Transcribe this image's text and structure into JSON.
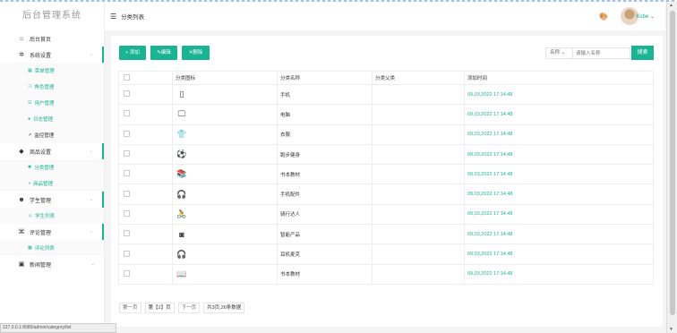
{
  "sidebar": {
    "logo": "后台管理系统",
    "items": [
      {
        "label": "后台首页",
        "icon": "home-icon",
        "glyph": "⌂"
      },
      {
        "label": "系统设置",
        "icon": "gear-icon",
        "glyph": "✲",
        "chevron": "⌄",
        "children": [
          {
            "label": "菜单管理",
            "glyph": "▦"
          },
          {
            "label": "角色管理",
            "glyph": "⚇"
          },
          {
            "label": "用户管理",
            "glyph": "☷"
          },
          {
            "label": "日志管理",
            "glyph": "●"
          },
          {
            "label": "监控管理",
            "glyph": "↗"
          }
        ]
      },
      {
        "label": "商品设置",
        "icon": "shopping-bag-icon",
        "glyph": "◆",
        "chevron": "⌄",
        "children": [
          {
            "label": "分类管理",
            "glyph": "✱"
          },
          {
            "label": "商品管理",
            "glyph": "◑"
          }
        ]
      },
      {
        "label": "学生管理",
        "icon": "users-icon",
        "glyph": "☻",
        "chevron": "⌄",
        "children": [
          {
            "label": "学生列表",
            "glyph": "☺"
          }
        ]
      },
      {
        "label": "评论管理",
        "icon": "command-icon",
        "glyph": "⌘",
        "chevron": "⌄",
        "children": [
          {
            "label": "评论列表",
            "glyph": "▩"
          }
        ]
      },
      {
        "label": "新闻管理",
        "icon": "newspaper-icon",
        "glyph": "▣",
        "chevron": "⌄"
      }
    ]
  },
  "statusbar": "127.0.0.1:8080/admin/category/list",
  "header": {
    "menu_glyph": "☰",
    "title": "分类列表",
    "palette_glyph": "🎨",
    "user": "Kobe ⌄"
  },
  "toolbar": {
    "add": "+ 添加",
    "edit": "✎编辑",
    "delete": "✕删除",
    "select": "名称 ⌄",
    "search_placeholder": "请输入名称",
    "search": "搜索"
  },
  "table": {
    "headers": [
      "",
      "分类图标",
      "分类名称",
      "分类父类",
      "添加时间"
    ],
    "rows": [
      {
        "icon": "▯",
        "icon_name": "phone-icon",
        "name": "手机",
        "parent": "",
        "date": "09,03,2022 17:14:48"
      },
      {
        "icon": "🖵",
        "icon_name": "monitor-icon",
        "name": "电脑",
        "parent": "",
        "date": "09,03,2022 17:14:48"
      },
      {
        "icon": "👕",
        "icon_name": "shirt-icon",
        "name": "衣服",
        "parent": "",
        "date": "09,03,2022 17:14:48"
      },
      {
        "icon": "⚽",
        "icon_name": "ball-icon",
        "name": "跑步健身",
        "parent": "",
        "date": "09,03,2022 17:14:48"
      },
      {
        "icon": "📚",
        "icon_name": "books-icon",
        "name": "书本教材",
        "parent": "",
        "date": "09,03,2022 17:14:48"
      },
      {
        "icon": "🎧",
        "icon_name": "headphones-icon",
        "name": "手机配件",
        "parent": "",
        "date": "09,03,2022 17:14:48"
      },
      {
        "icon": "🚴",
        "icon_name": "cyclist-icon",
        "name": "骑行达人",
        "parent": "",
        "date": "09,03,2022 17:14:48"
      },
      {
        "icon": "◙",
        "icon_name": "camera-icon",
        "name": "智能产品",
        "parent": "",
        "date": "09,03,2022 17:14:48"
      },
      {
        "icon": "🎧",
        "icon_name": "headphones-icon",
        "name": "耳机麦克",
        "parent": "",
        "date": "09,03,2022 17:14:48"
      },
      {
        "icon": "📖",
        "icon_name": "book-icon",
        "name": "书本教材",
        "parent": "",
        "date": "09,03,2022 17:14:48"
      }
    ]
  },
  "pager": {
    "prev": "第一页",
    "current": "第【1】页",
    "next": "下一页",
    "summary": "共3页,26条数据"
  }
}
